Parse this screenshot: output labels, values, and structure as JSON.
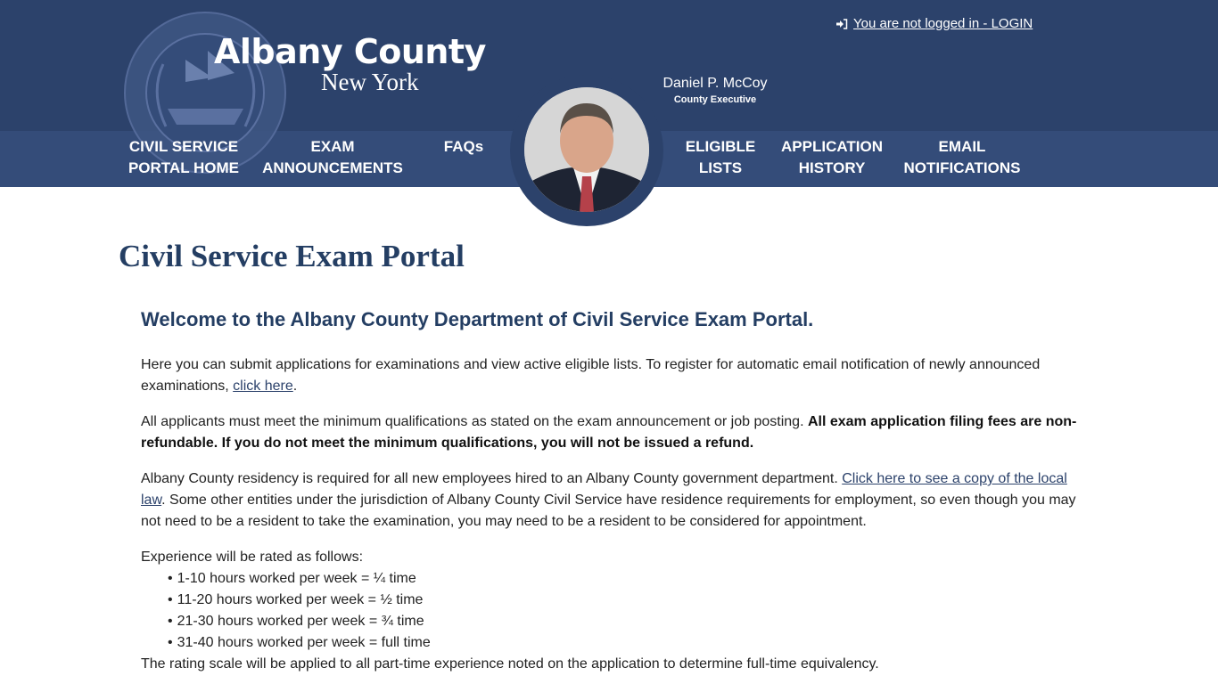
{
  "header": {
    "brand_title": "Albany County",
    "brand_subtitle": "New York",
    "login_link": "You are not logged in - LOGIN",
    "executive_name": "Daniel P. McCoy",
    "executive_title": "County Executive",
    "colors": {
      "header_bg": "#2c426b",
      "nav_bg": "#344c79",
      "heading": "#243e63"
    }
  },
  "nav": {
    "items": [
      {
        "line1": "CIVIL SERVICE",
        "line2": "PORTAL HOME"
      },
      {
        "line1": "EXAM",
        "line2": "ANNOUNCEMENTS"
      },
      {
        "line1": "FAQs",
        "line2": ""
      },
      {
        "line1": "ELIGIBLE",
        "line2": "LISTS"
      },
      {
        "line1": "APPLICATION",
        "line2": "HISTORY"
      },
      {
        "line1": "EMAIL",
        "line2": "NOTIFICATIONS"
      }
    ]
  },
  "main": {
    "page_title": "Civil Service Exam Portal",
    "welcome": "Welcome to the Albany County Department of Civil Service Exam Portal.",
    "p1": {
      "text": "Here you can submit applications for examinations and view active eligible lists. To register for automatic email notification of newly announced examinations, ",
      "link": "click here",
      "end": "."
    },
    "p2": {
      "text": "All applicants must meet the minimum qualifications as stated on the exam announcement or job posting. ",
      "bold": "All exam application filing fees are non-refundable. If you do not meet the minimum qualifications, you will not be issued a refund."
    },
    "p3": {
      "text": "Albany County residency is required for all new employees hired to an Albany County government department. ",
      "link": "Click here to see a copy of the local law",
      "end": ". Some other entities under the jurisdiction of Albany County Civil Service have residence requirements for employment, so even though you may not need to be a resident to take the examination, you may need to be a resident to be considered for appointment."
    },
    "experience": {
      "intro": "Experience will be rated as follows:",
      "items": [
        "1-10 hours worked per week = ¼ time",
        "11-20 hours worked per week = ½ time",
        "21-30 hours worked per week = ¾ time",
        "31-40 hours worked per week = full time"
      ],
      "footer": "The rating scale will be applied to all part-time experience noted on the application to determine full-time equivalency."
    }
  }
}
